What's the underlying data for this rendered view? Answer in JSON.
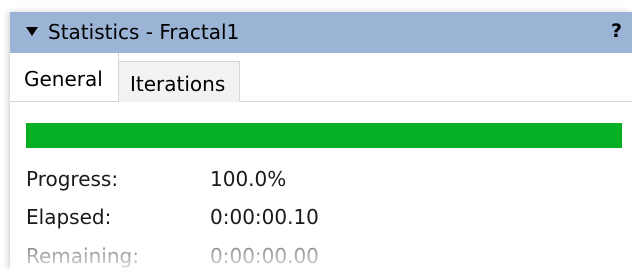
{
  "panel": {
    "title": "Statistics - Fractal1",
    "help_glyph": "?",
    "collapse_icon": "triangle-down-icon",
    "titlebar_color": "#9bb4d5"
  },
  "tabs": [
    {
      "label": "General",
      "selected": true
    },
    {
      "label": "Iterations",
      "selected": false
    }
  ],
  "progress_bar": {
    "value_percent": 100,
    "fill_color": "#06b025"
  },
  "stats": [
    {
      "label": "Progress:",
      "value": "100.0%"
    },
    {
      "label": "Elapsed:",
      "value": "0:00:00.10"
    },
    {
      "label": "Remaining:",
      "value": "0:00:00.00"
    }
  ]
}
